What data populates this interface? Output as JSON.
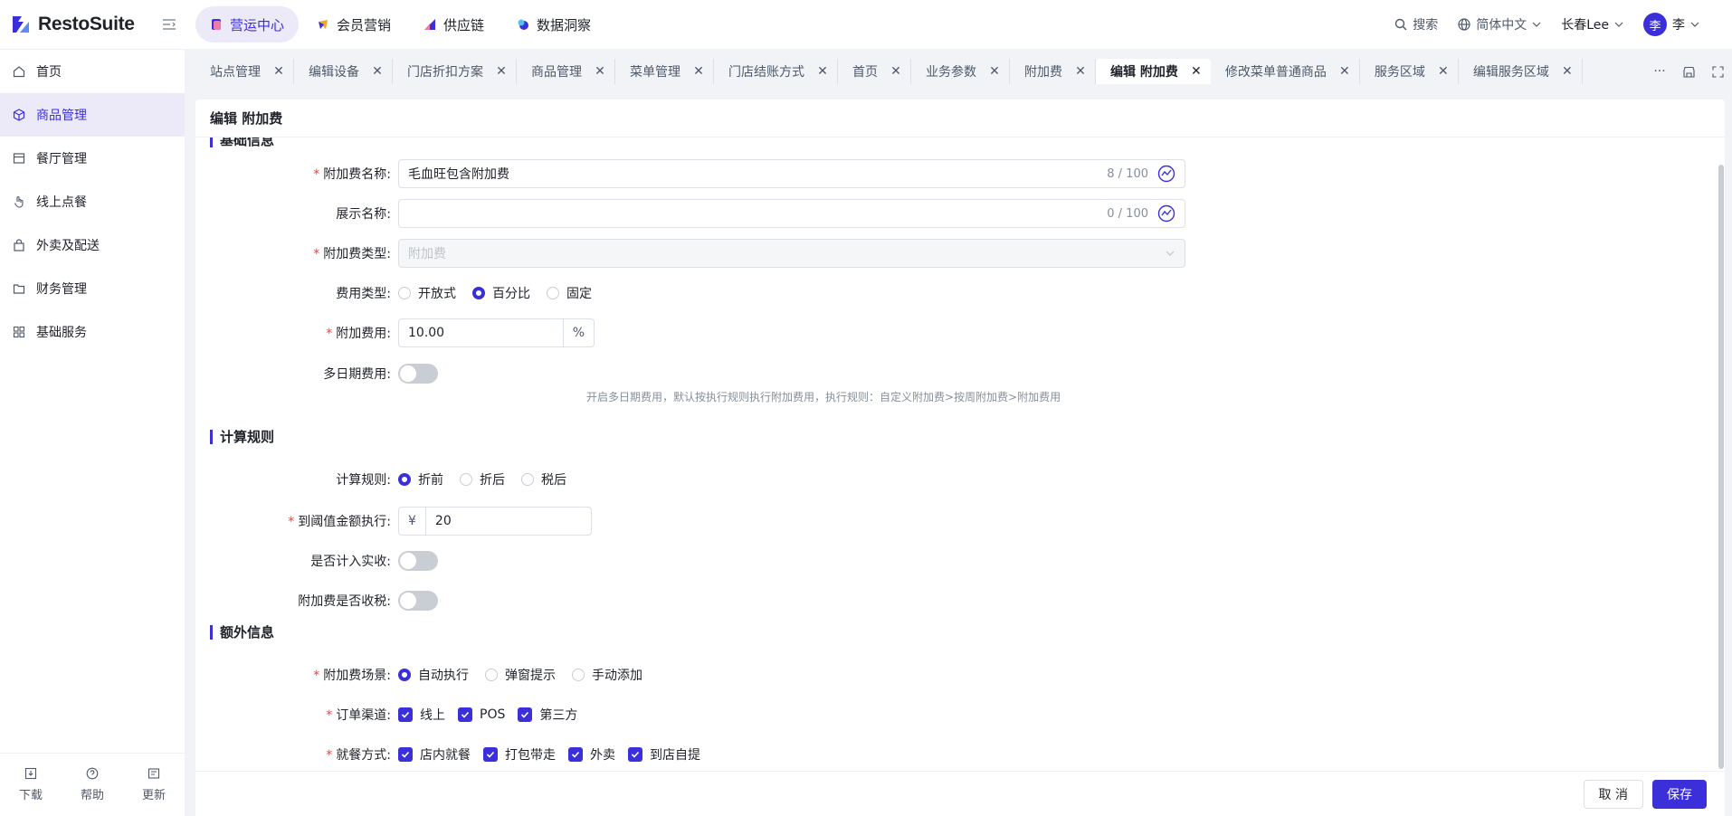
{
  "app": {
    "brand": "RestoSuite"
  },
  "topnav": {
    "items": [
      {
        "label": "营运中心",
        "active": true
      },
      {
        "label": "会员营销",
        "active": false
      },
      {
        "label": "供应链",
        "active": false
      },
      {
        "label": "数据洞察",
        "active": false
      }
    ],
    "search": "搜索",
    "language": "简体中文",
    "store": "长春Lee",
    "avatar_char": "李",
    "user": "李"
  },
  "sidebar": {
    "items": [
      {
        "label": "首页",
        "icon": "home-icon",
        "active": false
      },
      {
        "label": "商品管理",
        "icon": "cube-icon",
        "active": true
      },
      {
        "label": "餐厅管理",
        "icon": "store-icon",
        "active": false
      },
      {
        "label": "线上点餐",
        "icon": "hand-icon",
        "active": false
      },
      {
        "label": "外卖及配送",
        "icon": "bag-icon",
        "active": false
      },
      {
        "label": "财务管理",
        "icon": "folder-icon",
        "active": false
      },
      {
        "label": "基础服务",
        "icon": "grid-icon",
        "active": false
      }
    ],
    "bottom": [
      {
        "label": "下载",
        "icon": "download-icon"
      },
      {
        "label": "帮助",
        "icon": "help-icon"
      },
      {
        "label": "更新",
        "icon": "update-icon"
      }
    ]
  },
  "tabs": [
    {
      "label": "站点管理",
      "active": false
    },
    {
      "label": "编辑设备",
      "active": false
    },
    {
      "label": "门店折扣方案",
      "active": false
    },
    {
      "label": "商品管理",
      "active": false
    },
    {
      "label": "菜单管理",
      "active": false
    },
    {
      "label": "门店结账方式",
      "active": false
    },
    {
      "label": "首页",
      "active": false
    },
    {
      "label": "业务参数",
      "active": false
    },
    {
      "label": "附加费",
      "active": false
    },
    {
      "label": "编辑 附加费",
      "active": true
    },
    {
      "label": "修改菜单普通商品",
      "active": false
    },
    {
      "label": "服务区域",
      "active": false
    },
    {
      "label": "编辑服务区域",
      "active": false
    }
  ],
  "tab_more": "···",
  "page": {
    "title": "编辑 附加费",
    "sections": {
      "basic": "基础信息",
      "calc": "计算规则",
      "extra": "额外信息"
    },
    "fields": {
      "name": {
        "label": "附加费名称:",
        "value": "毛血旺包含附加费",
        "count": "8 / 100"
      },
      "display_name": {
        "label": "展示名称:",
        "value": "",
        "count": "0 / 100"
      },
      "type": {
        "label": "附加费类型:",
        "placeholder": "附加费"
      },
      "fee_type": {
        "label": "费用类型:",
        "options": [
          "开放式",
          "百分比",
          "固定"
        ],
        "selected": 1
      },
      "fee": {
        "label": "附加费用:",
        "value": "10.00",
        "suffix": "%"
      },
      "multi_date": {
        "label": "多日期费用:",
        "enabled": false,
        "hint": "开启多日期费用，默认按执行规则执行附加费用，执行规则：自定义附加费>按周附加费>附加费用"
      },
      "calc_rule": {
        "label": "计算规则:",
        "options": [
          "折前",
          "折后",
          "税后"
        ],
        "selected": 0
      },
      "threshold": {
        "label": "到阈值金额执行:",
        "prefix": "¥",
        "value": "20"
      },
      "count_real": {
        "label": "是否计入实收:",
        "enabled": false
      },
      "taxable": {
        "label": "附加费是否收税:",
        "enabled": false
      },
      "scene": {
        "label": "附加费场景:",
        "options": [
          "自动执行",
          "弹窗提示",
          "手动添加"
        ],
        "selected": 0
      },
      "channel": {
        "label": "订单渠道:",
        "options": [
          "线上",
          "POS",
          "第三方"
        ]
      },
      "dining": {
        "label": "就餐方式:",
        "options": [
          "店内就餐",
          "打包带走",
          "外卖",
          "到店自提"
        ]
      }
    },
    "buttons": {
      "cancel": "取 消",
      "save": "保存"
    }
  },
  "colors": {
    "accent": "#3b2fd9",
    "required": "#f53f3f"
  }
}
